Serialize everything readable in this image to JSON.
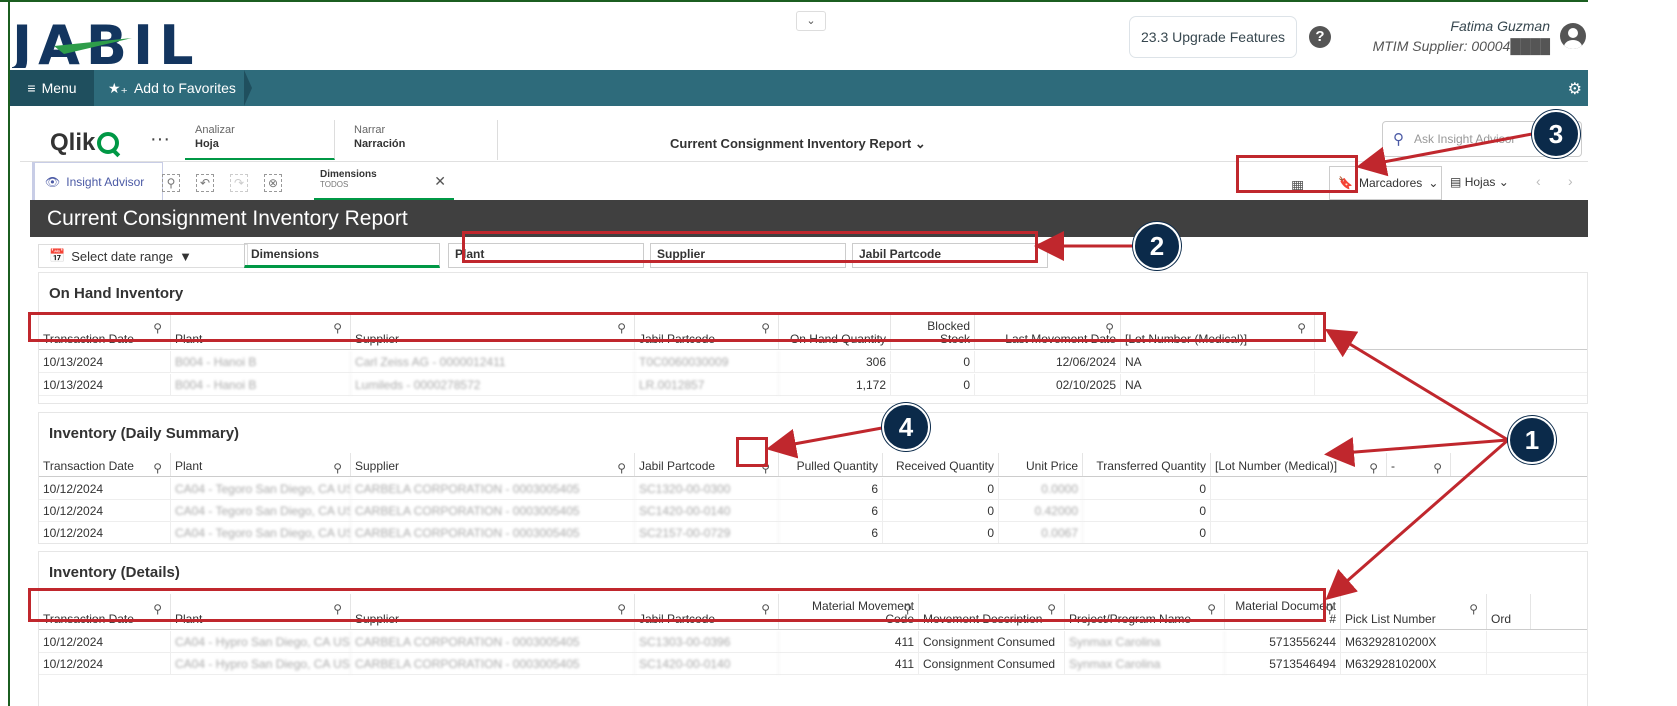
{
  "header": {
    "logo_text": "JABIL",
    "upgrade_label": "23.3 Upgrade Features",
    "help_icon": "?",
    "user_name": "Fatima Guzman",
    "user_supplier": "MTIM Supplier: 00004████"
  },
  "nav": {
    "menu_label": "Menu",
    "favorites_label": "Add to Favorites"
  },
  "qlik": {
    "brand": "Qlik",
    "dots": "···",
    "tab_analyze_top": "Analizar",
    "tab_analyze": "Hoja",
    "tab_narrate_top": "Narrar",
    "tab_narrate": "Narración",
    "report_title": "Current Consignment Inventory Report",
    "ask_placeholder": "Ask Insight Advisor",
    "insight_advisor": "Insight Advisor",
    "dimension_chip_title": "Dimensions",
    "dimension_chip_sub": "TODOS",
    "bookmarks": "Marcadores",
    "sheets": "Hojas"
  },
  "report": {
    "title": "Current Consignment Inventory Report",
    "date_range": "Select date range",
    "filters": {
      "dimensions": "Dimensions",
      "plant": "Plant",
      "supplier": "Supplier",
      "partcode": "Jabil Partcode"
    }
  },
  "on_hand": {
    "title": "On Hand Inventory",
    "columns": [
      "Transaction Date",
      "Plant",
      "Supplier",
      "Jabil Partcode",
      "On Hand Quantity",
      "Blocked Stock",
      "Last Movement Date",
      "[Lot Number (Medical)]"
    ],
    "rows": [
      [
        "10/13/2024",
        "B004 - Hanoi B",
        "Carl Zeiss AG - 0000012411",
        "T0C0060030009",
        "306",
        "0",
        "12/06/2024",
        "NA"
      ],
      [
        "10/13/2024",
        "B004 - Hanoi B",
        "Lumileds - 0000278572",
        "LR.0012857",
        "1,172",
        "0",
        "02/10/2025",
        "NA"
      ]
    ]
  },
  "daily": {
    "title": "Inventory (Daily Summary)",
    "columns": [
      "Transaction Date",
      "Plant",
      "Supplier",
      "Jabil Partcode",
      "Pulled Quantity",
      "Received Quantity",
      "Unit Price",
      "Transferred Quantity",
      "[Lot Number (Medical)]",
      "-"
    ],
    "rows": [
      [
        "10/12/2024",
        "CA04 - Tegoro San Diego, CA US",
        "CARBELA CORPORATION - 0003005405",
        "SC1320-00-0300",
        "6",
        "0",
        "0.0000",
        "0"
      ],
      [
        "10/12/2024",
        "CA04 - Tegoro San Diego, CA US",
        "CARBELA CORPORATION - 0003005405",
        "SC1420-00-0140",
        "6",
        "0",
        "0.42000",
        "0"
      ],
      [
        "10/12/2024",
        "CA04 - Tegoro San Diego, CA US",
        "CARBELA CORPORATION - 0003005405",
        "SC2157-00-0729",
        "6",
        "0",
        "0.0067",
        "0"
      ]
    ]
  },
  "details": {
    "title": "Inventory (Details)",
    "columns": [
      "Transaction Date",
      "Plant",
      "Supplier",
      "Jabil Partcode",
      "Material Movement Code",
      "Movement Description",
      "Project/Program Name",
      "Material Document #",
      "Pick List Number",
      "Ord"
    ],
    "rows": [
      [
        "10/12/2024",
        "CA04 - Hypro San Diego, CA US",
        "CARBELA CORPORATION - 0003005405",
        "SC1303-00-0396",
        "411",
        "Consignment Consumed",
        "Synmax Carolina",
        "5713556244",
        "M63292810200X"
      ],
      [
        "10/12/2024",
        "CA04 - Hypro San Diego, CA US",
        "CARBELA CORPORATION - 0003005405",
        "SC1420-00-0140",
        "411",
        "Consignment Consumed",
        "Synmax Carolina",
        "5713546494",
        "M63292810200X"
      ]
    ]
  },
  "callouts": [
    "1",
    "2",
    "3",
    "4"
  ],
  "colors": {
    "accent": "#009845",
    "nav": "#2e6b7b",
    "callout_red": "#c0272d",
    "badge": "#0b2a4a"
  }
}
